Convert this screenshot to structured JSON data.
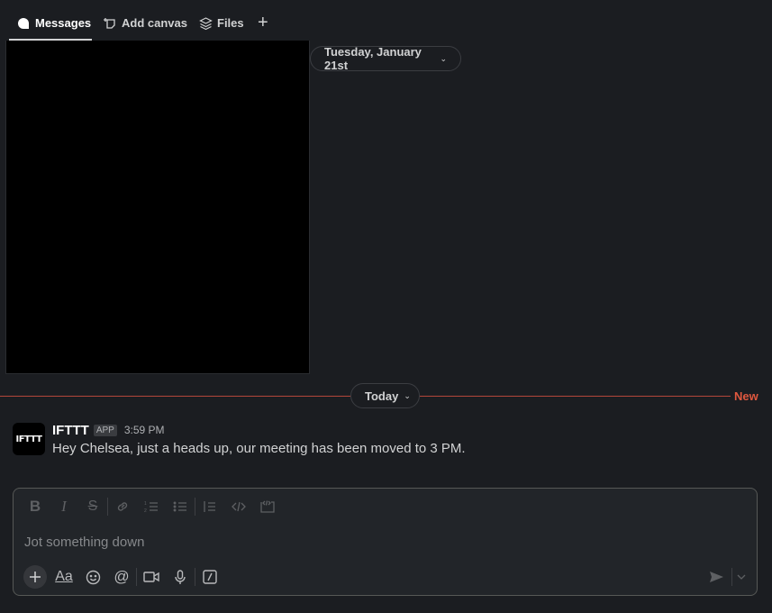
{
  "tabs": [
    {
      "label": "Messages",
      "icon": "message-bubble-icon",
      "active": true
    },
    {
      "label": "Add canvas",
      "icon": "canvas-icon",
      "active": false
    },
    {
      "label": "Files",
      "icon": "layers-icon",
      "active": false
    }
  ],
  "add_tab_label": "+",
  "dividers": {
    "previous_date": "Tuesday, January 21st",
    "today": "Today",
    "new_label": "New"
  },
  "message": {
    "avatar_text": "IFTTT",
    "sender": "IFTTT",
    "badge": "APP",
    "time": "3:59 PM",
    "text": "Hey Chelsea, just a heads up, our meeting has been moved to 3 PM."
  },
  "composer": {
    "placeholder": "Jot something down",
    "format_tools": [
      "bold",
      "italic",
      "strikethrough",
      "link",
      "ordered-list",
      "bulleted-list",
      "blockquote",
      "code",
      "code-block"
    ],
    "bottom_tools": [
      "attach",
      "formatting",
      "emoji",
      "mention",
      "video",
      "audio",
      "shortcuts"
    ]
  },
  "colors": {
    "background": "#1b1d21",
    "new_line": "#b3463a",
    "new_label": "#e0583f",
    "composer_border": "#565856"
  }
}
